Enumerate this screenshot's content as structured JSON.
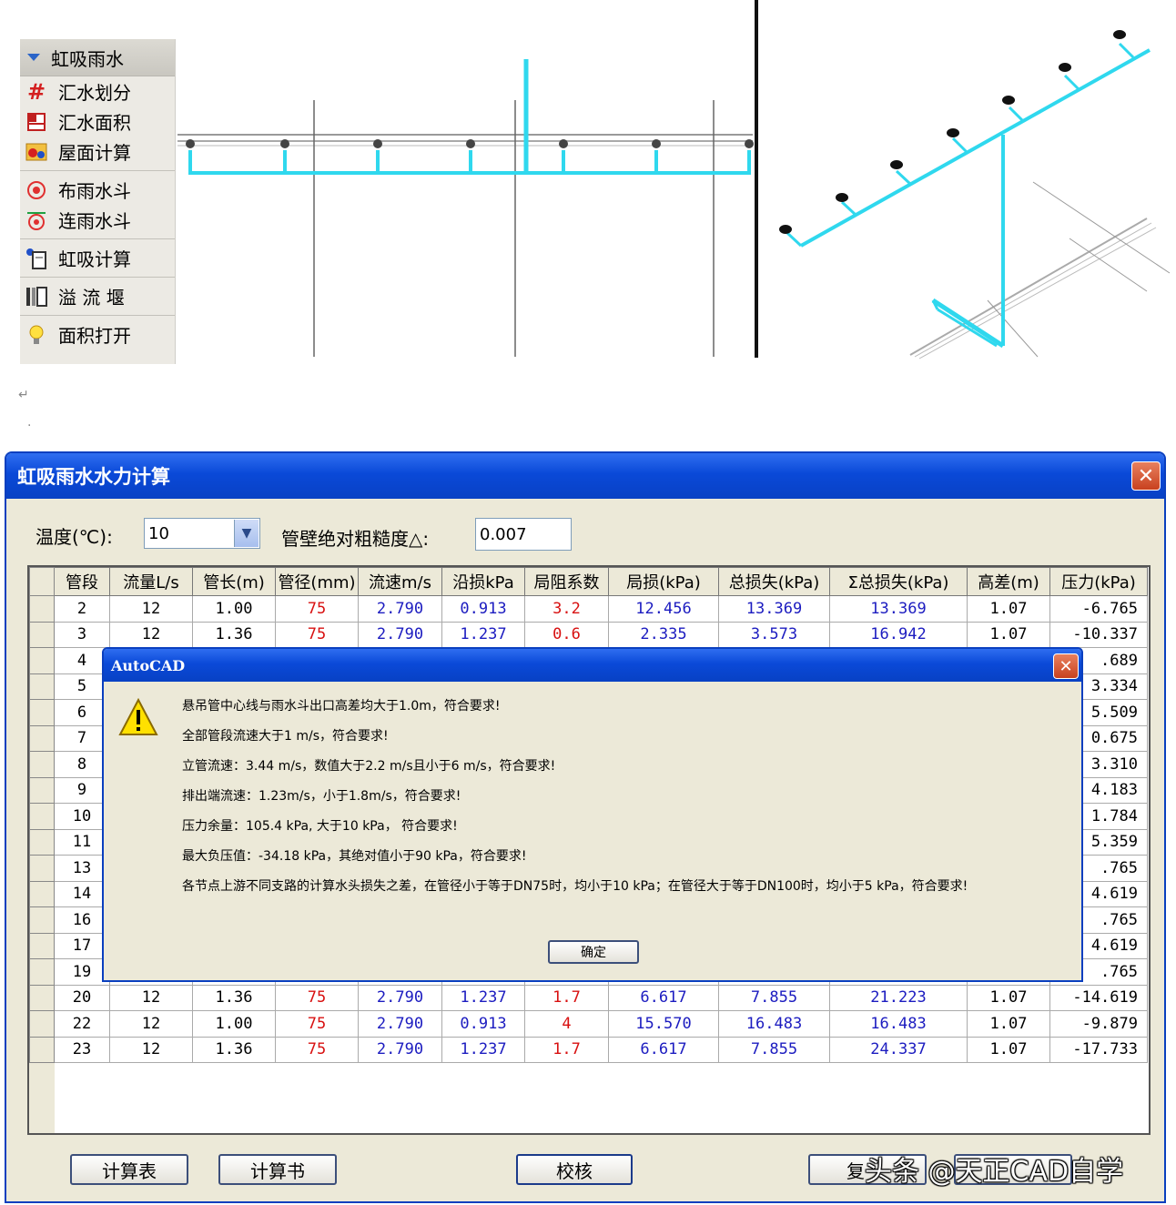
{
  "menu": {
    "header": "虹吸雨水",
    "items": [
      {
        "label": "汇水划分",
        "icon": "grid-hash-icon"
      },
      {
        "label": "汇水面积",
        "icon": "area-icon"
      },
      {
        "label": "屋面计算",
        "icon": "roof-calc-icon"
      },
      {
        "label": "布雨水斗",
        "icon": "rain-drain-icon"
      },
      {
        "label": "连雨水斗",
        "icon": "connect-drain-icon"
      },
      {
        "label": "虹吸计算",
        "icon": "siphon-calc-icon"
      },
      {
        "label": "溢 流 堰",
        "icon": "weir-icon"
      },
      {
        "label": "面积打开",
        "icon": "bulb-icon"
      }
    ]
  },
  "marks": {
    "return": "↵",
    "dot": "·"
  },
  "dialog": {
    "title": "虹吸雨水水力计算",
    "temp_label": "温度(℃):",
    "temp_value": "10",
    "rough_label": "管壁绝对粗糙度△:",
    "rough_value": "0.007",
    "columns": [
      "管段",
      "流量L/s",
      "管长(m)",
      "管径(mm)",
      "流速m/s",
      "沿损kPa",
      "局阻系数",
      "局损(kPa)",
      "总损失(kPa)",
      "Σ总损失(kPa)",
      "高差(m)",
      "压力(kPa)"
    ],
    "rows": [
      [
        "2",
        "12",
        "1.00",
        "75",
        "2.790",
        "0.913",
        "3.2",
        "12.456",
        "13.369",
        "13.369",
        "1.07",
        "-6.765"
      ],
      [
        "3",
        "12",
        "1.36",
        "75",
        "2.790",
        "1.237",
        "0.6",
        "2.335",
        "3.573",
        "16.942",
        "1.07",
        "-10.337"
      ],
      [
        "4",
        "",
        "",
        "",
        "",
        "",
        "",
        "",
        "",
        "",
        "",
        ".689"
      ],
      [
        "5",
        "",
        "",
        "",
        "",
        "",
        "",
        "",
        "",
        "",
        "",
        "3.334"
      ],
      [
        "6",
        "",
        "",
        "",
        "",
        "",
        "",
        "",
        "",
        "",
        "",
        "5.509"
      ],
      [
        "7",
        "",
        "",
        "",
        "",
        "",
        "",
        "",
        "",
        "",
        "",
        "0.675"
      ],
      [
        "8",
        "",
        "",
        "",
        "",
        "",
        "",
        "",
        "",
        "",
        "",
        "3.310"
      ],
      [
        "9",
        "",
        "",
        "",
        "",
        "",
        "",
        "",
        "",
        "",
        "",
        "4.183"
      ],
      [
        "10",
        "",
        "",
        "",
        "",
        "",
        "",
        "",
        "",
        "",
        "",
        "1.784"
      ],
      [
        "11",
        "",
        "",
        "",
        "",
        "",
        "",
        "",
        "",
        "",
        "",
        "5.359"
      ],
      [
        "13",
        "",
        "",
        "",
        "",
        "",
        "",
        "",
        "",
        "",
        "",
        ".765"
      ],
      [
        "14",
        "",
        "",
        "",
        "",
        "",
        "",
        "",
        "",
        "",
        "",
        "4.619"
      ],
      [
        "16",
        "",
        "",
        "",
        "",
        "",
        "",
        "",
        "",
        "",
        "",
        ".765"
      ],
      [
        "17",
        "",
        "",
        "",
        "",
        "",
        "",
        "",
        "",
        "",
        "",
        "4.619"
      ],
      [
        "19",
        "",
        "",
        "",
        "",
        "",
        "",
        "",
        "",
        "",
        "",
        ".765"
      ],
      [
        "20",
        "12",
        "1.36",
        "75",
        "2.790",
        "1.237",
        "1.7",
        "6.617",
        "7.855",
        "21.223",
        "1.07",
        "-14.619"
      ],
      [
        "22",
        "12",
        "1.00",
        "75",
        "2.790",
        "0.913",
        "4",
        "15.570",
        "16.483",
        "16.483",
        "1.07",
        "-9.879"
      ],
      [
        "23",
        "12",
        "1.36",
        "75",
        "2.790",
        "1.237",
        "1.7",
        "6.617",
        "7.855",
        "24.337",
        "1.07",
        "-17.733"
      ]
    ],
    "buttons": {
      "table": "计算表",
      "book": "计算书",
      "check": "校核",
      "copy": "复"
    }
  },
  "message": {
    "title": "AutoCAD",
    "lines": [
      "悬吊管中心线与雨水斗出口高差均大于1.0m，符合要求!",
      "全部管段流速大于1 m/s，符合要求!",
      "立管流速：3.44 m/s，数值大于2.2 m/s且小于6 m/s，符合要求!",
      "排出端流速：1.23m/s，小于1.8m/s，符合要求!",
      "压力余量：105.4 kPa, 大于10 kPa， 符合要求!",
      "最大负压值：-34.18 kPa，其绝对值小于90 kPa，符合要求!",
      "各节点上游不同支路的计算水头损失之差，在管径小于等于DN75时，均小于10 kPa；在管径大于等于DN100时，均小于5 kPa，符合要求!"
    ],
    "ok": "确定"
  },
  "watermark": "头条 @天正CAD自学",
  "colors": {
    "pipe": "#2fd8ee",
    "title_blue": "#0a49d8",
    "red_value": "#d81010",
    "blue_value": "#1c1cc0"
  }
}
